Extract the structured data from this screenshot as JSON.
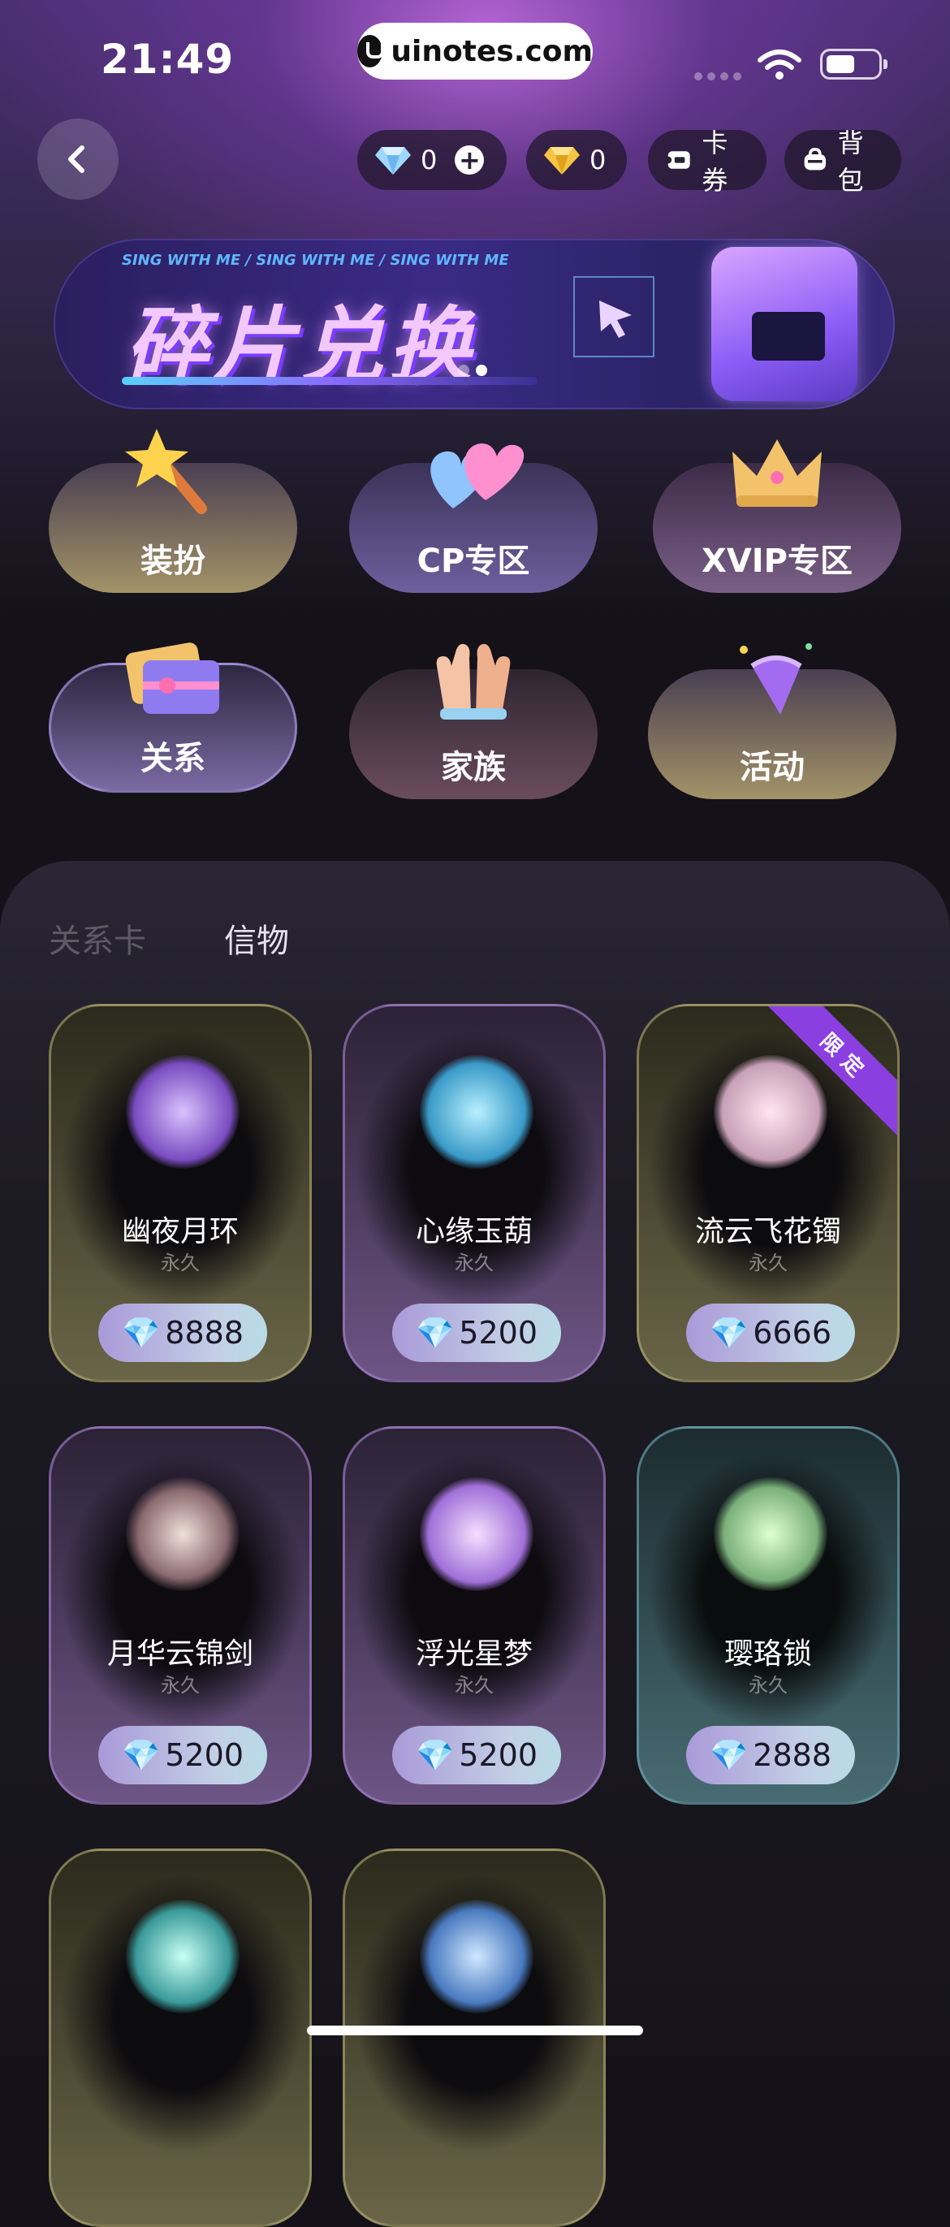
{
  "status_bar": {
    "time": "21:49",
    "url": "uinotes.com"
  },
  "header": {
    "diamond_count": "0",
    "gold_gem_count": "0",
    "coupon_label": "卡券",
    "bag_label": "背包"
  },
  "banner": {
    "small_text": "SING WITH ME  /  SING WITH ME  /  SING WITH ME",
    "title": "碎片兑换",
    "dots_total": 2,
    "dots_active_index": 1
  },
  "categories": [
    {
      "label": "装扮",
      "icon": "magic-wand-icon"
    },
    {
      "label": "CP专区",
      "icon": "hearts-icon"
    },
    {
      "label": "XVIP专区",
      "icon": "crown-icon"
    },
    {
      "label": "关系",
      "icon": "gift-card-icon"
    },
    {
      "label": "家族",
      "icon": "clapping-hands-icon"
    },
    {
      "label": "活动",
      "icon": "party-popper-icon"
    }
  ],
  "tabs": [
    {
      "label": "关系卡",
      "active": false
    },
    {
      "label": "信物",
      "active": true
    }
  ],
  "items": [
    {
      "name": "幽夜月环",
      "duration": "永久",
      "price": "8888",
      "theme": "gold",
      "ribbon": ""
    },
    {
      "name": "心缘玉葫",
      "duration": "永久",
      "price": "5200",
      "theme": "purple",
      "ribbon": ""
    },
    {
      "name": "流云飞花镯",
      "duration": "永久",
      "price": "6666",
      "theme": "gold",
      "ribbon": "限定"
    },
    {
      "name": "月华云锦剑",
      "duration": "永久",
      "price": "5200",
      "theme": "purple",
      "ribbon": ""
    },
    {
      "name": "浮光星梦",
      "duration": "永久",
      "price": "5200",
      "theme": "purple",
      "ribbon": ""
    },
    {
      "name": "璎珞锁",
      "duration": "永久",
      "price": "2888",
      "theme": "teal",
      "ribbon": ""
    },
    {
      "name": "",
      "duration": "",
      "price": "",
      "theme": "gold",
      "ribbon": ""
    },
    {
      "name": "",
      "duration": "",
      "price": "",
      "theme": "gold",
      "ribbon": ""
    }
  ],
  "colors": {
    "background": "#141218",
    "accent_purple": "#8b3fe0",
    "price_pill": "#c3cfe6"
  }
}
